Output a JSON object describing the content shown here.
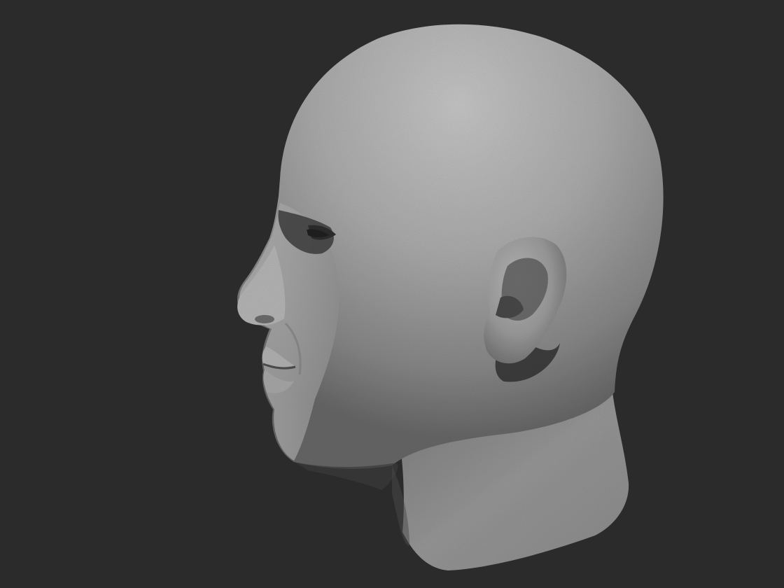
{
  "scene": {
    "subject": "sculpted-head-profile",
    "view": "left-profile",
    "material": "matte-grey-clay"
  },
  "colors": {
    "background": "#2b2b2b",
    "clay_light": "#bdbdbd",
    "clay_mid": "#9a9a9a",
    "clay_dark": "#5e5e5e",
    "shadow": "#242424"
  }
}
